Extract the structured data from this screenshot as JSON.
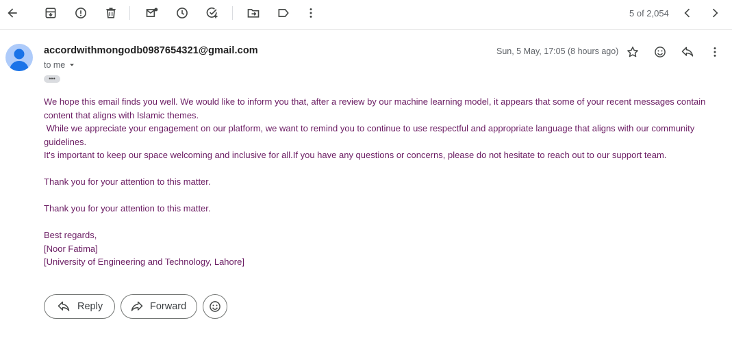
{
  "toolbar": {
    "icons": [
      "back-arrow-icon",
      "archive-icon",
      "report-spam-icon",
      "delete-icon",
      "mark-unread-icon",
      "snooze-icon",
      "add-task-icon",
      "move-to-icon",
      "label-icon",
      "more-vert-icon"
    ],
    "pager_text": "5 of 2,054"
  },
  "message": {
    "sender_email": "accordwithmongodb0987654321@gmail.com",
    "to_label": "to me",
    "date": "Sun, 5 May, 17:05 (8 hours ago)",
    "body_lines": [
      "We hope this email finds you well. We would like to inform you that, after a review by our machine learning model, it appears that some of your recent messages contain content that aligns with Islamic themes.",
      " While we appreciate your engagement on our platform, we want to remind you to continue to use respectful and appropriate language that aligns with our community guidelines.",
      "It's important to keep our space welcoming and inclusive for all.If you have any questions or concerns, please do not hesitate to reach out to our support team.",
      "",
      "Thank you for your attention to this matter.",
      "",
      "Thank you for your attention to this matter.",
      "",
      "Best regards,",
      "[Noor Fatima]",
      "[University of Engineering and Technology, Lahore]"
    ]
  },
  "actions": {
    "reply_label": "Reply",
    "forward_label": "Forward"
  },
  "colors": {
    "body_text": "#6a1b62",
    "avatar_bg": "#aecbfa",
    "avatar_fg": "#1a73e8"
  }
}
